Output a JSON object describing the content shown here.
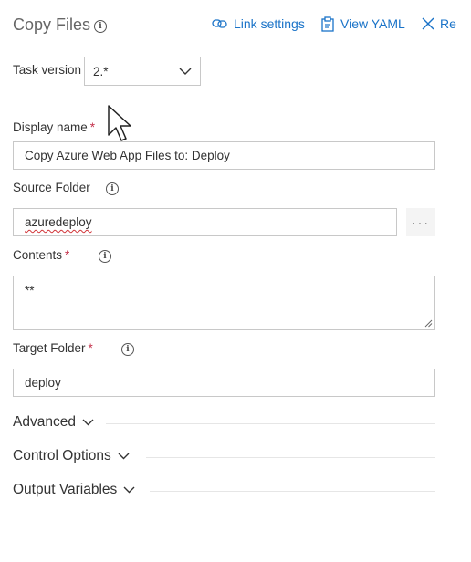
{
  "header": {
    "title": "Copy Files",
    "link_settings_label": "Link settings",
    "view_yaml_label": "View YAML",
    "remove_label": "Re"
  },
  "task_version": {
    "label": "Task version",
    "value": "2.*"
  },
  "display_name": {
    "label": "Display name",
    "required_mark": "*",
    "value": "Copy Azure Web App Files to: Deploy"
  },
  "source_folder": {
    "label": "Source Folder",
    "value": "azuredeploy",
    "browse_label": "···"
  },
  "contents": {
    "label": "Contents",
    "required_mark": "*",
    "value": "**"
  },
  "target_folder": {
    "label": "Target Folder",
    "required_mark": "*",
    "value": "deploy"
  },
  "sections": {
    "advanced": "Advanced",
    "control_options": "Control Options",
    "output_variables": "Output Variables"
  },
  "colors": {
    "link": "#1a73c8",
    "required": "#c4314b",
    "border": "#c8c8c8"
  }
}
